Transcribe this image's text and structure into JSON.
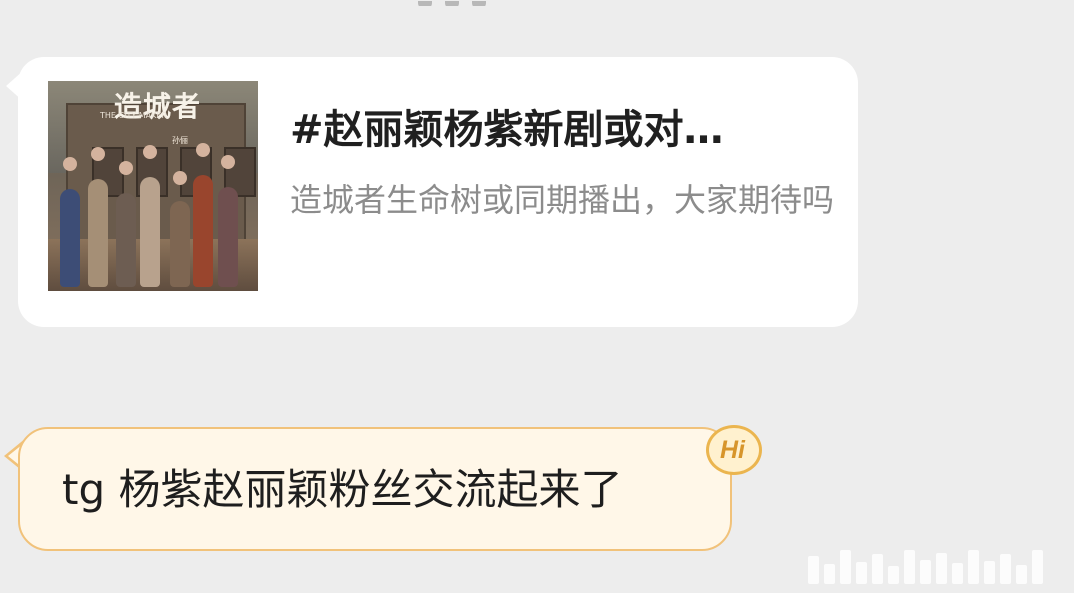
{
  "shared_card": {
    "thumbnail": {
      "poster_title": "造城者",
      "poster_subtitle": "THE CITY MAKER",
      "poster_credit": "孙俪"
    },
    "title": "#赵丽颖杨紫新剧或对…",
    "description": "造城者生命树或同期播出，大家期待吗"
  },
  "message": {
    "text": "tg 杨紫赵丽颖粉丝交流起来了",
    "badge_label": "Hi"
  },
  "colors": {
    "background": "#ededed",
    "card_background": "#ffffff",
    "message_background": "#fff7e8",
    "message_border": "#f1c27a",
    "badge_accent": "#d7952b"
  }
}
